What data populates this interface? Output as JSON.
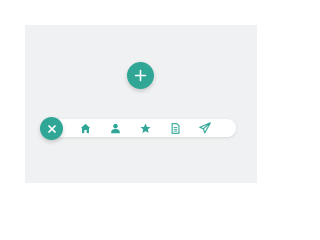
{
  "colors": {
    "accent": "#2fa696",
    "background": "#f0f1f2",
    "bar": "#ffffff"
  },
  "fab": {
    "icon": "plus-icon"
  },
  "menu": {
    "toggle_icon": "close-icon",
    "items": [
      {
        "icon": "home-icon"
      },
      {
        "icon": "user-icon"
      },
      {
        "icon": "star-icon"
      },
      {
        "icon": "document-icon"
      },
      {
        "icon": "send-icon"
      }
    ]
  }
}
